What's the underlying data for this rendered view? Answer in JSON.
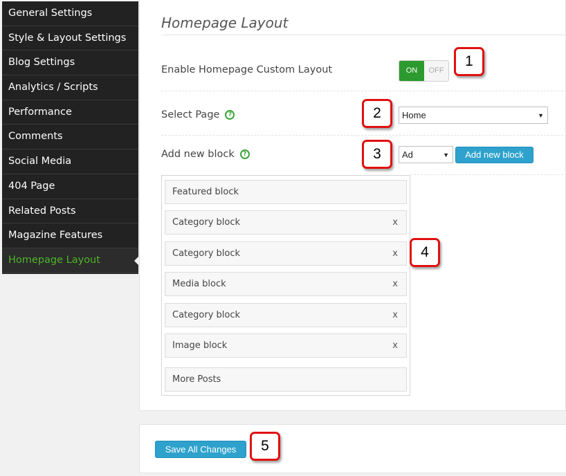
{
  "sidebar": {
    "items": [
      {
        "label": "General Settings"
      },
      {
        "label": "Style & Layout Settings"
      },
      {
        "label": "Blog Settings"
      },
      {
        "label": "Analytics / Scripts"
      },
      {
        "label": "Performance"
      },
      {
        "label": "Comments"
      },
      {
        "label": "Social Media"
      },
      {
        "label": "404 Page"
      },
      {
        "label": "Related Posts"
      },
      {
        "label": "Magazine Features"
      },
      {
        "label": "Homepage Layout"
      }
    ],
    "active_index": 10
  },
  "main": {
    "title": "Homepage Layout",
    "enable_custom_layout": {
      "label": "Enable Homepage Custom Layout",
      "on_label": "ON",
      "off_label": "OFF",
      "state": "on"
    },
    "select_page": {
      "label": "Select Page",
      "value": "Home"
    },
    "add_block": {
      "label": "Add new block",
      "type_value": "Ad",
      "button_label": "Add new block"
    },
    "blocks": [
      {
        "label": "Featured block",
        "removable": false
      },
      {
        "label": "Category block",
        "removable": true,
        "remove_label": "x"
      },
      {
        "label": "Category block",
        "removable": true,
        "remove_label": "x"
      },
      {
        "label": "Media block",
        "removable": true,
        "remove_label": "x"
      },
      {
        "label": "Category block",
        "removable": true,
        "remove_label": "x"
      },
      {
        "label": "Image block",
        "removable": true,
        "remove_label": "x"
      },
      {
        "label": "More Posts",
        "removable": false
      }
    ]
  },
  "footer": {
    "save_label": "Save All Changes"
  },
  "callouts": [
    "1",
    "2",
    "3",
    "4",
    "5"
  ],
  "colors": {
    "accent_green": "#4eb52b",
    "toggle_on": "#2c9a2f",
    "button_blue": "#2ea2cc",
    "callout_red": "#e01010",
    "sidebar_bg": "#222222"
  }
}
